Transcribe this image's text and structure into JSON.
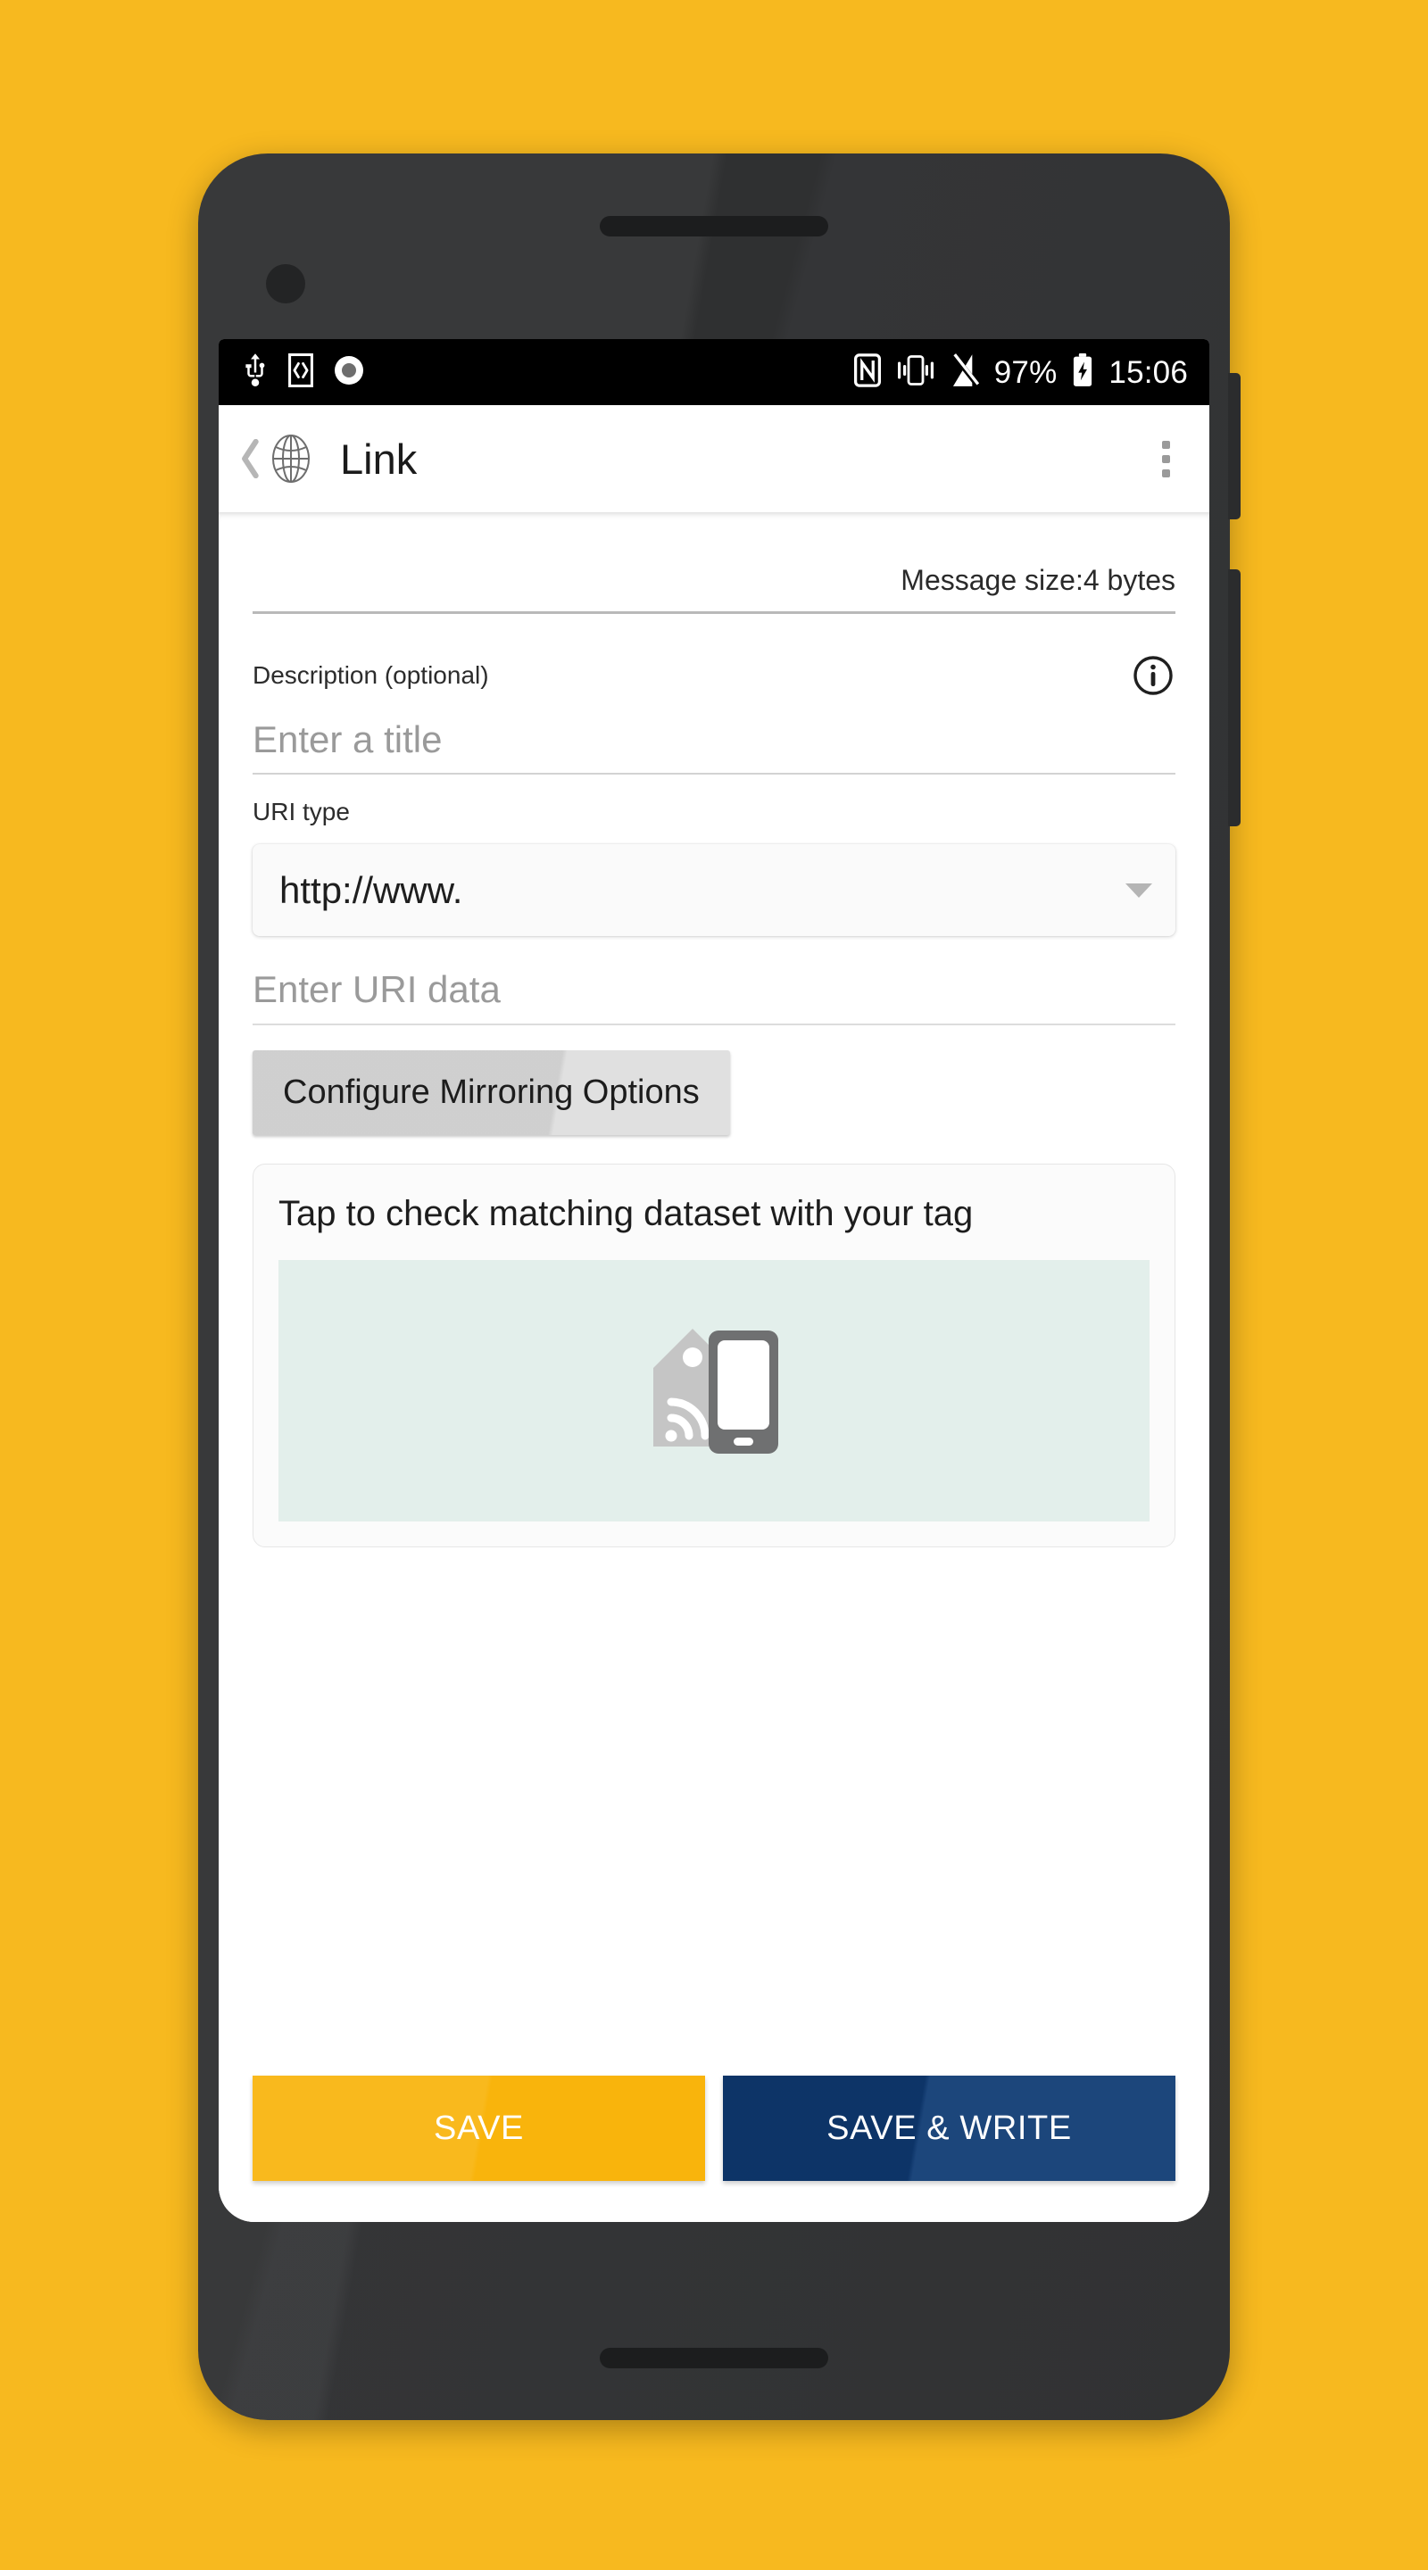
{
  "background_color": "#F7B91F",
  "status_bar": {
    "left_icons": [
      "usb-icon",
      "developer-mode-icon",
      "screen-record-icon"
    ],
    "right_icons": [
      "nfc-icon",
      "vibrate-icon",
      "signal-off-icon"
    ],
    "battery_percent": "97%",
    "battery_state_icon": "battery-charging-icon",
    "time": "15:06"
  },
  "toolbar": {
    "back_icon": "back-chevron-icon",
    "app_icon": "globe-icon",
    "title": "Link",
    "overflow_icon": "overflow-menu-icon"
  },
  "content": {
    "message_size": "Message size:4 bytes",
    "description": {
      "label": "Description (optional)",
      "info_icon": "info-icon",
      "input_placeholder": "Enter a title",
      "input_value": ""
    },
    "uri_type": {
      "label": "URI type",
      "selected": "http://www.",
      "caret_icon": "chevron-down-icon"
    },
    "uri_data": {
      "input_placeholder": "Enter URI data",
      "input_value": ""
    },
    "mirroring_button": "Configure Mirroring Options",
    "tap_card": {
      "title": "Tap to check matching dataset with your tag",
      "illustration_icon": "nfc-tag-phone-icon",
      "illustration_bg": "#e3efeb"
    }
  },
  "actions": {
    "save_label": "SAVE",
    "save_color": "#F9B40C",
    "save_write_label": "SAVE & WRITE",
    "save_write_color": "#0E3A73"
  }
}
